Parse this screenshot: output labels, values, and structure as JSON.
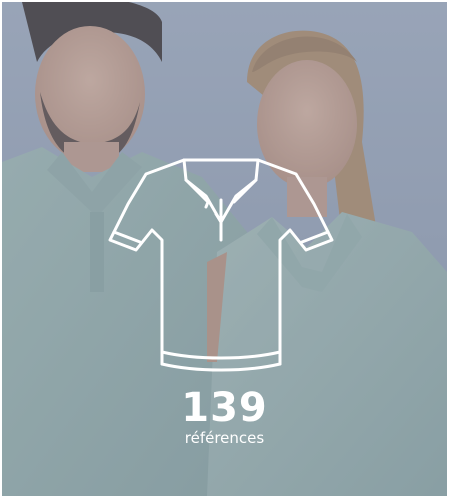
{
  "tile": {
    "count": "139",
    "label": "références",
    "icon": "polo-shirt-icon",
    "overlay_color": "#7887a0",
    "shirt_color": "#9fb8b0"
  }
}
